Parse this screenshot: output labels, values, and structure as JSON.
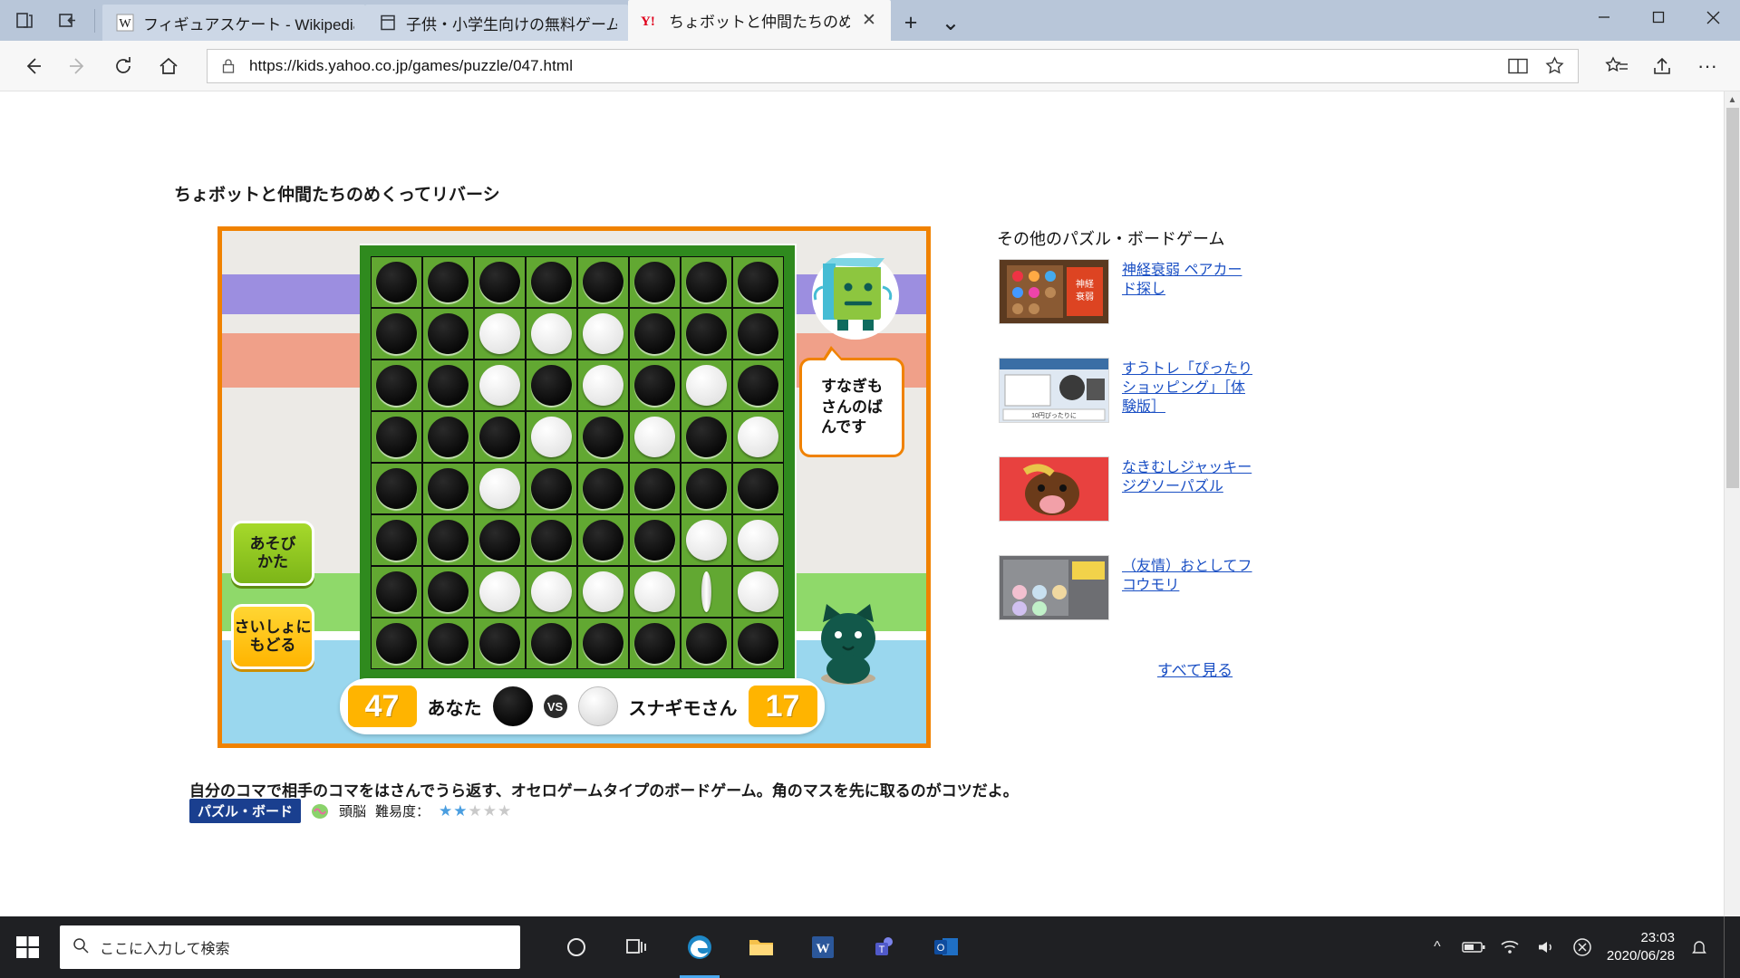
{
  "browser": {
    "tabs": [
      {
        "title": "フィギュアスケート - Wikipedia",
        "favicon": "wikipedia-icon",
        "active": false
      },
      {
        "title": "子供・小学生向けの無料ゲーム",
        "favicon": "page-icon",
        "active": false
      },
      {
        "title": "ちょボットと仲間たちのめく",
        "favicon": "yahoo-icon",
        "active": true
      }
    ],
    "tab_tools": {
      "tab_preview": "tab-preview-icon",
      "set_aside": "set-aside-icon"
    },
    "new_tab_label": "+",
    "tab_menu_label": "⌄",
    "window_controls": {
      "minimize": "−",
      "maximize": "▢",
      "close": "✕"
    },
    "nav": {
      "back": "←",
      "forward": "→",
      "refresh": "↻",
      "home": "⌂",
      "reading_view": "reading-view-icon",
      "favorite": "star-icon",
      "favorites_hub": "favorites-hub-icon",
      "share": "share-icon",
      "more": "···"
    },
    "url": "https://kids.yahoo.co.jp/games/puzzle/047.html",
    "lock_icon": "lock-icon"
  },
  "page": {
    "title": "ちょボットと仲間たちのめくってリバーシ",
    "description": "自分のコマで相手のコマをはさんでうら返す、オセロゲームタイプのボードゲーム。角のマスを先に取るのがコツだよ。",
    "meta": {
      "tag": "パズル・ボード",
      "brain_icon": "brain-icon",
      "brain_label": "頭脳",
      "difficulty_label": "難易度：",
      "difficulty_filled": 2,
      "difficulty_total": 5,
      "star_glyph": "★"
    }
  },
  "game": {
    "buttons": [
      {
        "name": "how-to-play",
        "line1": "あそび",
        "line2": "かた"
      },
      {
        "name": "reset",
        "line1": "さいしょに",
        "line2": "もどる"
      }
    ],
    "speech_bubble": "すなぎもさんのばんです",
    "speech_bubble_lines": [
      "すなぎも",
      "さんのば",
      "んです"
    ],
    "scoreboard": {
      "player_score": "47",
      "player_name": "あなた",
      "vs": "VS",
      "opponent_name": "スナギモさん",
      "opponent_score": "17"
    },
    "board": {
      "rows": 8,
      "cols": 8,
      "legend": {
        "b": "black",
        "w": "white",
        "f": "flipping",
        "e": "empty"
      },
      "cells": [
        [
          "b",
          "b",
          "b",
          "b",
          "b",
          "b",
          "b",
          "b"
        ],
        [
          "b",
          "b",
          "w",
          "w",
          "w",
          "b",
          "b",
          "b"
        ],
        [
          "b",
          "b",
          "w",
          "b",
          "w",
          "b",
          "w",
          "b"
        ],
        [
          "b",
          "b",
          "b",
          "w",
          "b",
          "w",
          "b",
          "w"
        ],
        [
          "b",
          "b",
          "w",
          "b",
          "b",
          "b",
          "b",
          "b"
        ],
        [
          "b",
          "b",
          "b",
          "b",
          "b",
          "b",
          "w",
          "w"
        ],
        [
          "b",
          "b",
          "w",
          "w",
          "w",
          "w",
          "f",
          "w"
        ],
        [
          "b",
          "b",
          "b",
          "b",
          "b",
          "b",
          "b",
          "b"
        ]
      ]
    }
  },
  "sidebar": {
    "heading": "その他のパズル・ボードゲーム",
    "items": [
      {
        "label": "神経衰弱 ペアカード探し",
        "thumb": "memory-game-thumb"
      },
      {
        "label": "すうトレ「ぴったりショッピング」［体験版］",
        "thumb": "shopping-game-thumb"
      },
      {
        "label": "なきむしジャッキー ジグソーパズル",
        "thumb": "jigsaw-game-thumb"
      },
      {
        "label": "（友情）おとしてフコウモリ",
        "thumb": "bat-game-thumb"
      }
    ],
    "see_all": "すべて見る"
  },
  "taskbar": {
    "start_icon": "windows-start-icon",
    "search_placeholder": "ここに入力して検索",
    "search_icon": "search-icon",
    "apps": [
      {
        "name": "cortana",
        "icon": "cortana-icon"
      },
      {
        "name": "task-view",
        "icon": "task-view-icon"
      },
      {
        "name": "edge",
        "icon": "edge-icon",
        "active": true
      },
      {
        "name": "file-explorer",
        "icon": "folder-icon"
      },
      {
        "name": "word",
        "icon": "word-icon"
      },
      {
        "name": "teams",
        "icon": "teams-icon"
      },
      {
        "name": "outlook",
        "icon": "outlook-icon"
      }
    ],
    "tray": {
      "chevron": "^",
      "battery": "battery-icon",
      "network": "wifi-icon",
      "volume": "volume-icon",
      "action_center": "action-center-icon"
    },
    "time": "23:03",
    "date": "2020/06/28"
  }
}
